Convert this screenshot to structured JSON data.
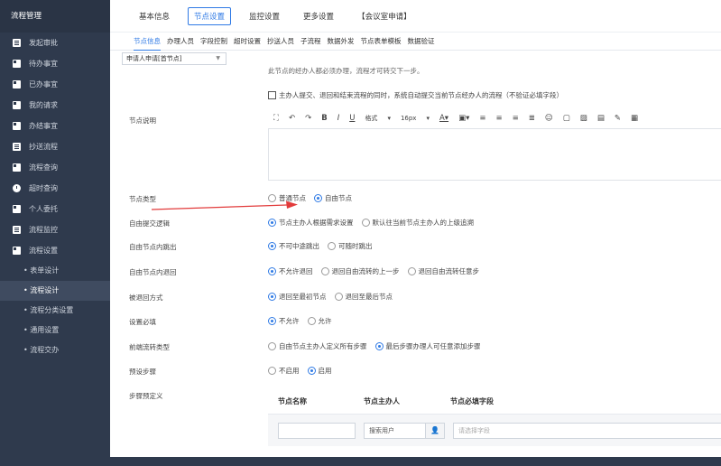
{
  "sidebar": {
    "title": "流程管理",
    "items": [
      {
        "label": "发起审批",
        "icon": "doc-icon"
      },
      {
        "label": "待办事宜",
        "icon": "box-icon"
      },
      {
        "label": "已办事宜",
        "icon": "box-icon"
      },
      {
        "label": "我的请求",
        "icon": "box-icon"
      },
      {
        "label": "办结事宜",
        "icon": "box-icon"
      },
      {
        "label": "抄送流程",
        "icon": "doc-icon"
      },
      {
        "label": "流程查询",
        "icon": "box-icon"
      },
      {
        "label": "超时查询",
        "icon": "clock-icon"
      },
      {
        "label": "个人委托",
        "icon": "box-icon"
      },
      {
        "label": "流程监控",
        "icon": "doc-icon"
      },
      {
        "label": "流程设置",
        "icon": "box-icon"
      }
    ],
    "subitems": [
      "• 表单设计",
      "• 流程设计",
      "• 流程分类设置",
      "• 通用设置",
      "• 流程交办"
    ]
  },
  "top_tabs": [
    "基本信息",
    "节点设置",
    "监控设置",
    "更多设置",
    "【会议室申请】"
  ],
  "sub_tabs": [
    "节点信息",
    "办理人员",
    "字段控制",
    "超时设置",
    "抄送人员",
    "子流程",
    "数据外发",
    "节点表单模板",
    "数据验证"
  ],
  "node_select": "申请人申请[首节点]",
  "hint_text": "此节点的经办人都必须办理，流程才可转交下一步。",
  "checkbox_label": "主办人提交、退回和结束流程的同时，系统自动提交当前节点经办人的流程（不验证必填字段）",
  "labels": {
    "node_desc": "节点说明",
    "node_type": "节点类型",
    "free_submit": "自由提交逻辑",
    "free_jump": "自由节点内跳出",
    "free_return": "自由节点内退回",
    "returned_mode": "被退回方式",
    "required": "设置必填",
    "pre_flow": "前端流转类型",
    "preset_steps": "预设步骤",
    "step_predef": "步骤预定义"
  },
  "editor_toolbar": {
    "format": "格式",
    "font_size": "16px"
  },
  "options": {
    "node_type": [
      "普通节点",
      "自由节点"
    ],
    "free_submit": [
      "节点主办人根据需求设置",
      "默认往当前节点主办人的上级追溯"
    ],
    "free_jump": [
      "不可中途跳出",
      "可随时跳出"
    ],
    "free_return": [
      "不允许退回",
      "退回自由流转的上一步",
      "退回自由流转任意步"
    ],
    "returned_mode": [
      "退回至最初节点",
      "退回至最后节点"
    ],
    "required": [
      "不允许",
      "允许"
    ],
    "pre_flow": [
      "自由节点主办人定义所有步骤",
      "最后步骤办理人可任意添加步骤"
    ],
    "preset_steps": [
      "不启用",
      "启用"
    ]
  },
  "steps": {
    "col_name": "节点名称",
    "col_owner": "节点主办人",
    "col_required": "节点必填字段",
    "owner_placeholder": "搜索用户",
    "field_placeholder": "请选择字段"
  },
  "colors": {
    "sidebar_bg": "#2f3a4d",
    "accent": "#2f7ae5",
    "arrow": "#e23b3b"
  }
}
